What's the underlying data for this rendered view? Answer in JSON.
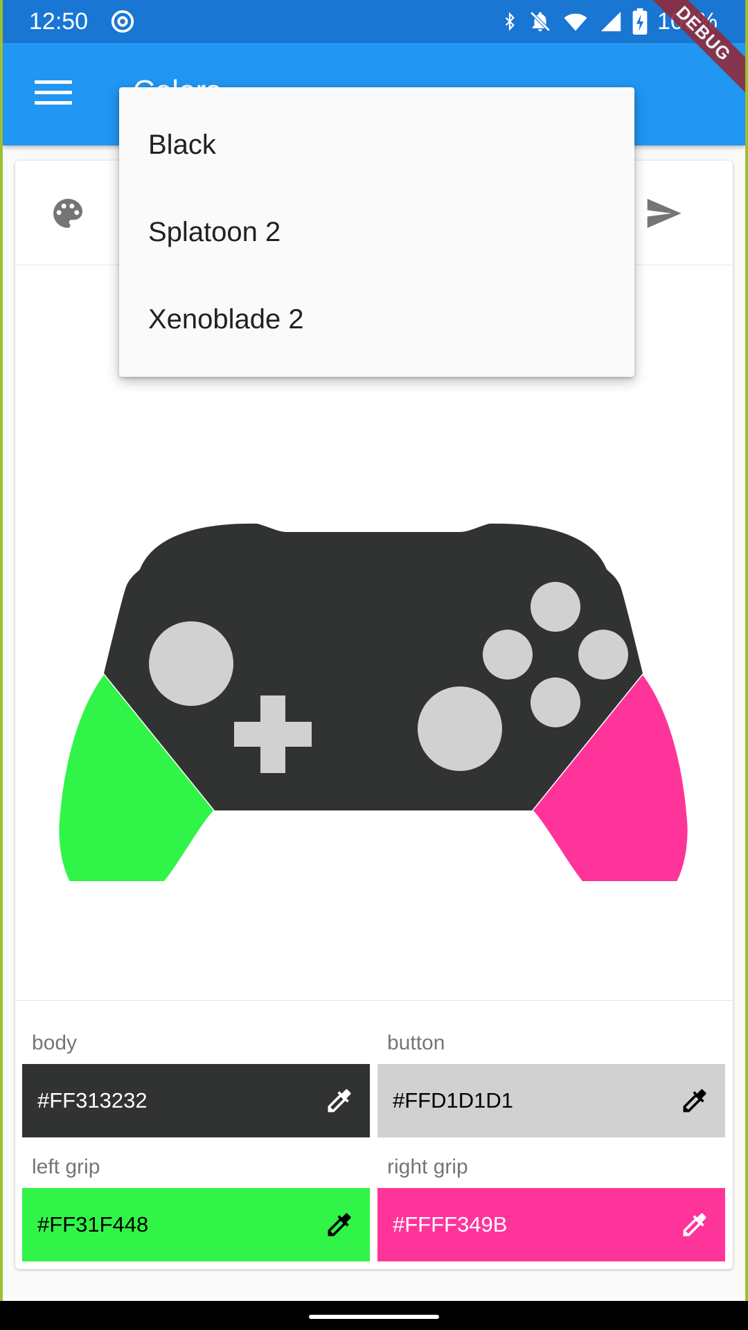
{
  "status_bar": {
    "time": "12:50",
    "battery": "100%",
    "icons": [
      "at-sign-icon",
      "bluetooth-icon",
      "notifications-off-icon",
      "wifi-icon",
      "cell-signal-icon",
      "battery-charging-icon"
    ]
  },
  "app_bar": {
    "title": "Colors",
    "debug_banner": "DEBUG",
    "icons": [
      "menu-icon"
    ]
  },
  "card": {
    "toolbar_icons": [
      "palette-icon",
      "send-icon"
    ],
    "preset_menu": {
      "items": [
        "Black",
        "Splatoon 2",
        "Xenoblade 2"
      ]
    },
    "controller_colors": {
      "body": "#313232",
      "buttons": "#D1D1D1",
      "left_grip": "#31F448",
      "right_grip": "#FF349B"
    },
    "color_fields": [
      {
        "label": "body",
        "value": "#FF313232",
        "bg": "#313232",
        "fg": "#FFFFFF",
        "icon": "colorize-icon"
      },
      {
        "label": "button",
        "value": "#FFD1D1D1",
        "bg": "#D1D1D1",
        "fg": "#000000",
        "icon": "colorize-icon"
      },
      {
        "label": "left grip",
        "value": "#FF31F448",
        "bg": "#31F448",
        "fg": "#000000",
        "icon": "colorize-icon"
      },
      {
        "label": "right grip",
        "value": "#FFFF349B",
        "bg": "#FF349B",
        "fg": "#FFFFFF",
        "icon": "colorize-icon"
      }
    ]
  },
  "colors": {
    "app_bar": "#2196F3",
    "status_bar": "#1976D2",
    "debug_banner": "#8E2D3F"
  }
}
